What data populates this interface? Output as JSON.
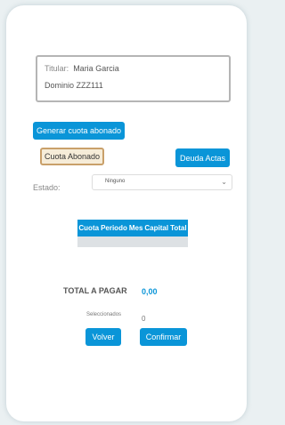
{
  "info": {
    "titular_label": "Titular:",
    "titular_value": "Maria Garcia",
    "dominio_label": "Dominio",
    "dominio_value": "ZZZ111"
  },
  "buttons": {
    "generar": "Generar cuota abonado",
    "cuota_abonado": "Cuota Abonado",
    "deuda_actas": "Deuda Actas",
    "volver": "Volver",
    "confirmar": "Confirmar"
  },
  "estado": {
    "label": "Estado:",
    "selected": "Ninguno"
  },
  "table": {
    "columns": [
      "Cuota",
      "Periodo",
      "Mes",
      "Capital",
      "Total"
    ]
  },
  "summary": {
    "total_label": "TOTAL A PAGAR",
    "total_value": "0,00",
    "selected_label": "Seleccionados",
    "selected_value": "0"
  },
  "colors": {
    "accent": "#0a95d8",
    "highlight_button": "#f6ecd8"
  }
}
